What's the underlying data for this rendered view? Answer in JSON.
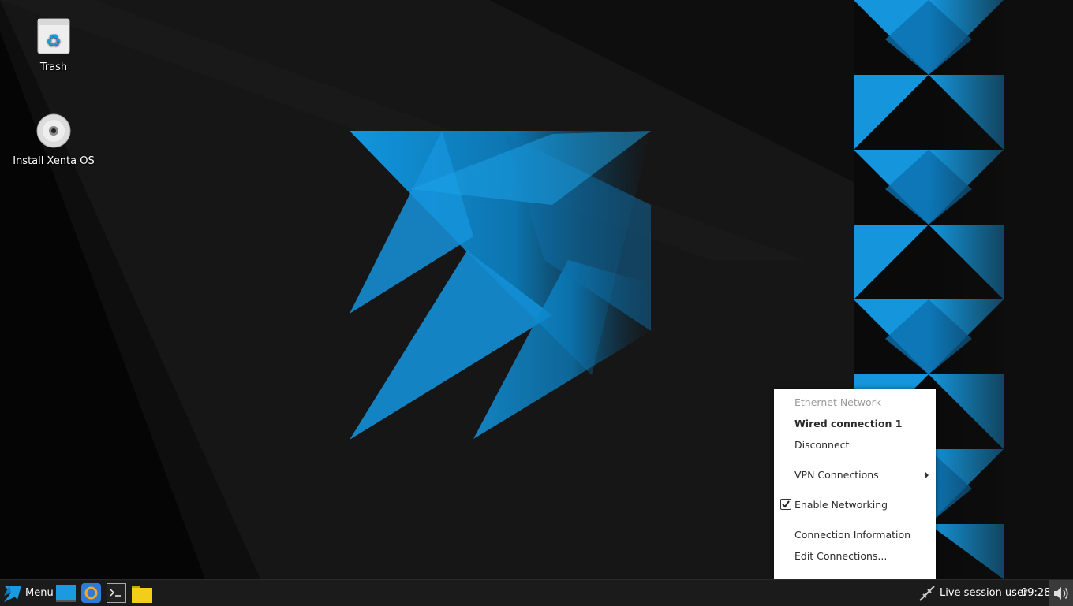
{
  "desktop": {
    "icons": [
      {
        "label": "Trash",
        "icon": "trash-icon"
      },
      {
        "label": "Install Xenta OS",
        "icon": "disc-icon"
      }
    ]
  },
  "network_menu": {
    "header": "Ethernet Network",
    "connection": "Wired connection 1",
    "disconnect": "Disconnect",
    "vpn": "VPN Connections",
    "enable_networking": "Enable Networking",
    "enable_networking_checked": true,
    "connection_info": "Connection Information",
    "edit_connections": "Edit Connections..."
  },
  "taskbar": {
    "menu_label": "Menu",
    "launchers": [
      "desktop-icon",
      "browser-icon",
      "terminal-icon",
      "folder-icon"
    ],
    "tray_network_icon": "network-icon",
    "user": "Live session user",
    "clock": "09:28",
    "volume_icon": "volume-icon"
  },
  "colors": {
    "accent": "#1a9be0",
    "taskbar": "#1b1b1b",
    "menu_bg": "#ffffff"
  }
}
